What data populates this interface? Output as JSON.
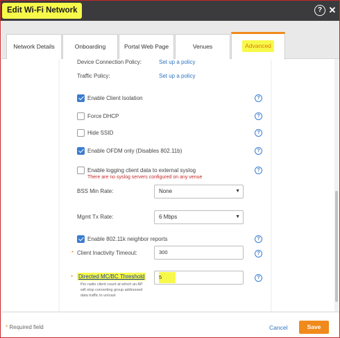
{
  "dialog": {
    "title": "Edit Wi-Fi Network"
  },
  "tabs": [
    {
      "label": "Network Details"
    },
    {
      "label": "Onboarding"
    },
    {
      "label": "Portal Web Page"
    },
    {
      "label": "Venues"
    },
    {
      "label": "Advanced"
    }
  ],
  "policies": {
    "device_label": "Device Connection Policy:",
    "device_link": "Set up a policy",
    "traffic_label": "Traffic Policy:",
    "traffic_link": "Set up a policy"
  },
  "options": {
    "client_isolation": {
      "label": "Enable Client Isolation",
      "checked": true
    },
    "force_dhcp": {
      "label": "Force DHCP",
      "checked": false
    },
    "hide_ssid": {
      "label": "Hide SSID",
      "checked": false
    },
    "ofdm_only": {
      "label": "Enable OFDM only (Disables 802.11b)",
      "checked": true
    },
    "syslog": {
      "label": "Enable logging client data to external syslog",
      "checked": false,
      "warning": "There are no syslog servers configured on any venue"
    },
    "neighbor_reports": {
      "label": "Enable 802.11k neighbor reports",
      "checked": true
    }
  },
  "bss_min_rate": {
    "label": "BSS Min Rate:",
    "value": "None"
  },
  "mgmt_tx_rate": {
    "label": "Mgmt Tx Rate:",
    "value": "6 Mbps"
  },
  "client_inactivity": {
    "required_mark": "*",
    "label": "Client Inactivity Timeout:",
    "value": "300"
  },
  "directed_threshold": {
    "required_mark": "*",
    "label": "Directed MC/BC Threshold",
    "value": "5",
    "hint": "Per radio client count at which an AP will stop converting group addressed data traffic to unicast"
  },
  "help_glyph": "?",
  "footer": {
    "required_mark": "*",
    "required_text": "Required field",
    "cancel": "Cancel",
    "save": "Save"
  },
  "colors": {
    "accent": "#f08a1c",
    "link": "#2c73c2",
    "highlight": "#f7f94a",
    "titlebar": "#3b3b3d"
  }
}
